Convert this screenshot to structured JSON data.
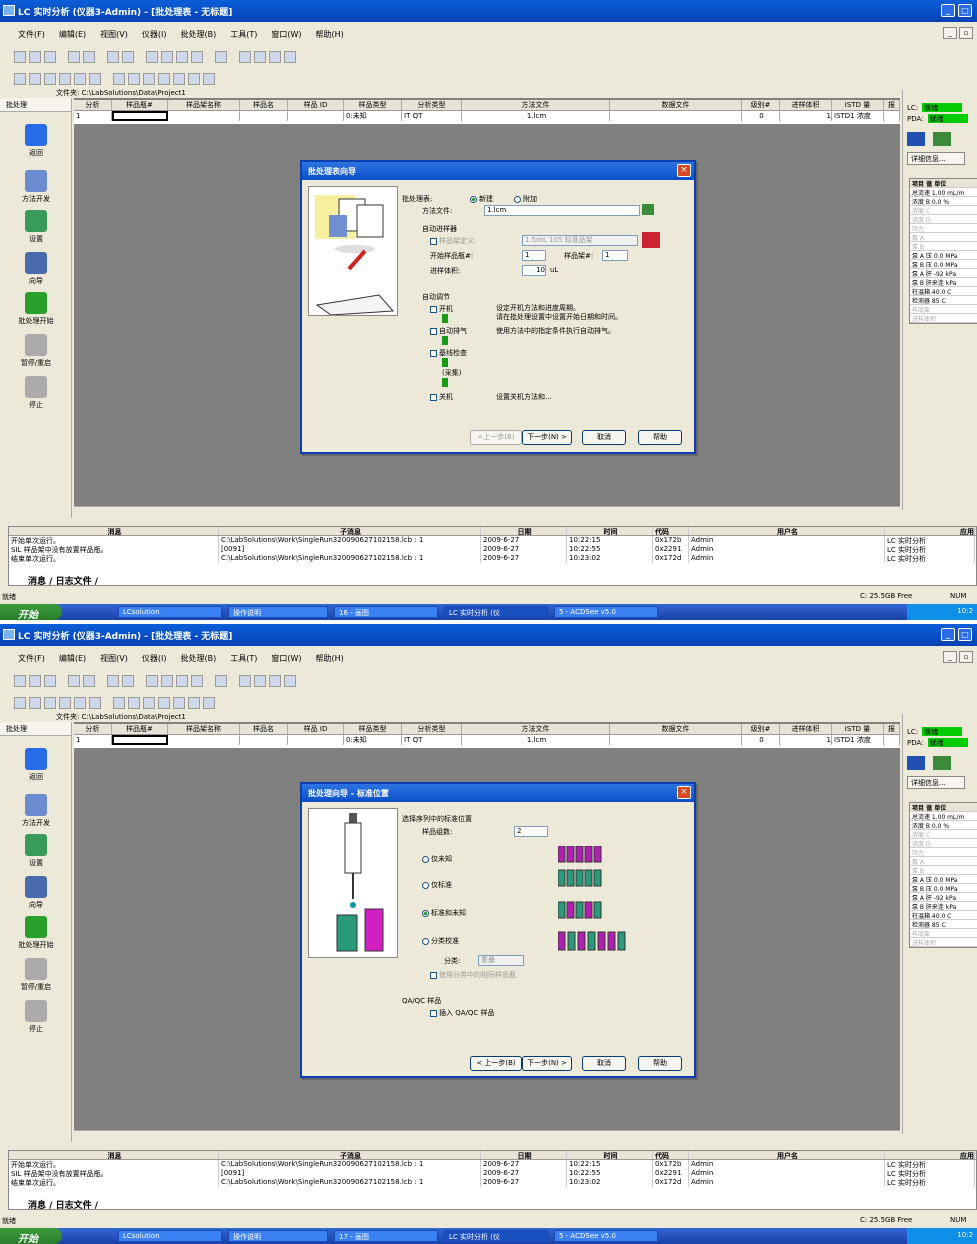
{
  "window": {
    "title": "LC 实时分析 (仪器3-Admin) - [批处理表 - 无标题]"
  },
  "menu": [
    "文件(F)",
    "编辑(E)",
    "视图(V)",
    "仪器(I)",
    "批处理(B)",
    "工具(T)",
    "窗口(W)",
    "帮助(H)"
  ],
  "file_path": "文件夹: C:\\LabSolutions\\Data\\Project1",
  "left_toolbar": {
    "header": "批处理",
    "items": [
      "返回",
      "方法开发",
      "设置",
      "向导",
      "批处理开始",
      "暂停/重启",
      "停止"
    ]
  },
  "grid": {
    "headers": [
      "分析",
      "样品瓶#",
      "样品架名称",
      "样品名",
      "样品 ID",
      "样品类型",
      "分析类型",
      "方法文件",
      "数据文件",
      "级别#",
      "进样体积",
      "ISTD 量",
      "报"
    ],
    "row": [
      "1",
      "",
      "",
      "",
      "",
      "0:未知",
      "IT QT",
      "1.lcm",
      "",
      "0",
      "1",
      "ISTD1 浓度",
      ""
    ]
  },
  "right_panel": {
    "lc_label": "LC:",
    "lc_status": "就绪",
    "pda_label": "PDA:",
    "pda_status": "就绪",
    "detail_button": "详细信息...",
    "table_headers": [
      "项目",
      "值",
      "单位"
    ],
    "rows": [
      "总流速 1.00 mL/m",
      "浓度 B 0.0 %",
      "浓度 C",
      "浓度 D",
      "压力",
      "泵 A",
      "泵 B",
      "泵 A 压 0.0 MPa",
      "泵 B 压 0.0 MPa",
      "泵 A 肝 -92 kPa",
      "泵 B 肝来连 kPa",
      "柱温箱 40.0 C",
      "检测器 85 C",
      "样品架",
      "进样体积"
    ]
  },
  "dialog1": {
    "title": "批处理表向导",
    "batch_label": "批处理表:",
    "radio_new": "新建",
    "radio_append": "附加",
    "method_label": "方法文件:",
    "method_value": "1.lcm",
    "autosampler_label": "自动进样器",
    "rack_check": "样品架定义:",
    "rack_value": "1.5mL 105 标准品架",
    "start_vial_label": "开始样品瓶#:",
    "start_vial_value": "1",
    "rack_num_label": "样品架#:",
    "rack_num_value": "1",
    "inj_vol_label": "进样体积:",
    "inj_vol_value": "10",
    "inj_vol_unit": "uL",
    "auto_adjust": "自动调节",
    "startup": "开机",
    "startup_desc": "设定开机方法和进度周期。\n请在批处理设置中设置开始日期和时间。",
    "auto_purge": "自动排气",
    "auto_purge_desc": "使用方法中的指定条件执行自动排气。",
    "baseline": "基线检查",
    "acquire": "(采集)",
    "shutdown": "关机",
    "shutdown_desc": "设置关机方法和...",
    "btn_back": "<上一步(B)",
    "btn_next": "下一步(N) >",
    "btn_cancel": "取消",
    "btn_help": "帮助"
  },
  "dialog2": {
    "title": "批处理向导 - 标准位置",
    "prompt": "选择序列中的标准位置",
    "groups_label": "样品组数:",
    "groups_value": "2",
    "opt_unknown": "仅未知",
    "opt_standard": "仅标准",
    "opt_std_unknown": "标准和未知",
    "opt_bracket": "分类校准",
    "class_label": "分类:",
    "class_value": "重叠",
    "class_check": "使用分类中的相同样品瓶",
    "qaqc_label": "QA/QC 样品",
    "qaqc_check": "插入 QA/QC 样品",
    "btn_back": "< 上一步(B)",
    "btn_next": "下一步(N) >",
    "btn_cancel": "取消",
    "btn_help": "帮助"
  },
  "messages": {
    "headers": [
      "消息",
      "子消息",
      "日期",
      "时间",
      "代码",
      "用户名",
      "应用"
    ],
    "rows": [
      [
        "开始单次运行。",
        "C:\\LabSolutions\\Work\\SingleRun320090627102158.lcb : 1",
        "2009-6-27",
        "10:22:15",
        "0x172b",
        "Admin",
        "LC 实时分析"
      ],
      [
        "SIL 样品架中没有放置样品瓶。",
        "[0091]",
        "2009-6-27",
        "10:22:55",
        "0x2291",
        "Admin",
        "LC 实时分析"
      ],
      [
        "结束单次运行。",
        "C:\\LabSolutions\\Work\\SingleRun320090627102158.lcb : 1",
        "2009-6-27",
        "10:23:02",
        "0x172d",
        "Admin",
        "LC 实时分析"
      ]
    ],
    "tab_messages": "消息",
    "tab_log": "日志文件"
  },
  "statusbar": {
    "left": "就绪",
    "disk": "C: 25.5GB Free",
    "mode": "NUM"
  },
  "taskbar": {
    "start": "开始",
    "tasks": [
      "LCsolution",
      "操作说明",
      "16 - 画图",
      "LC 实时分析 (仪",
      "5 - ACDSee v5.0"
    ],
    "tasks2": [
      "LCsolution",
      "操作说明",
      "17 - 画图",
      "LC 实时分析 (仪",
      "5 - ACDSee v5.0"
    ],
    "clock": "10:2"
  },
  "colors": {
    "title": "#0a4ec8",
    "green_status": "#00cc00",
    "task": "#3c81f3"
  }
}
